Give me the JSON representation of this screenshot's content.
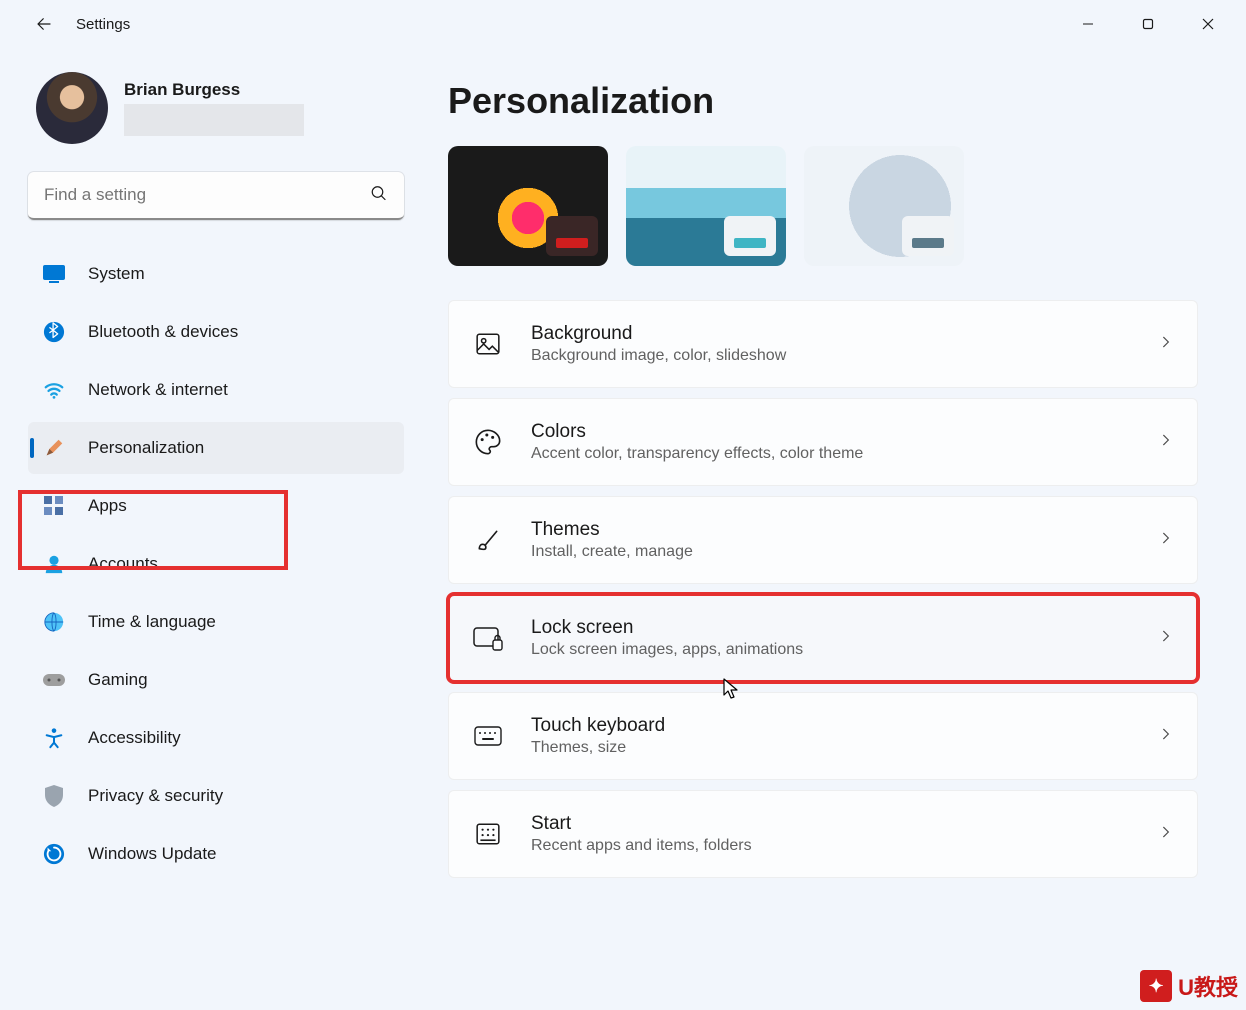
{
  "app": {
    "title": "Settings"
  },
  "profile": {
    "name": "Brian Burgess"
  },
  "search": {
    "placeholder": "Find a setting"
  },
  "sidebar": {
    "items": [
      {
        "label": "System"
      },
      {
        "label": "Bluetooth & devices"
      },
      {
        "label": "Network & internet"
      },
      {
        "label": "Personalization"
      },
      {
        "label": "Apps"
      },
      {
        "label": "Accounts"
      },
      {
        "label": "Time & language"
      },
      {
        "label": "Gaming"
      },
      {
        "label": "Accessibility"
      },
      {
        "label": "Privacy & security"
      },
      {
        "label": "Windows Update"
      }
    ]
  },
  "page": {
    "title": "Personalization"
  },
  "cards": [
    {
      "title": "Background",
      "sub": "Background image, color, slideshow"
    },
    {
      "title": "Colors",
      "sub": "Accent color, transparency effects, color theme"
    },
    {
      "title": "Themes",
      "sub": "Install, create, manage"
    },
    {
      "title": "Lock screen",
      "sub": "Lock screen images, apps, animations"
    },
    {
      "title": "Touch keyboard",
      "sub": "Themes, size"
    },
    {
      "title": "Start",
      "sub": "Recent apps and items, folders"
    }
  ],
  "watermark": {
    "text": "U教授"
  }
}
